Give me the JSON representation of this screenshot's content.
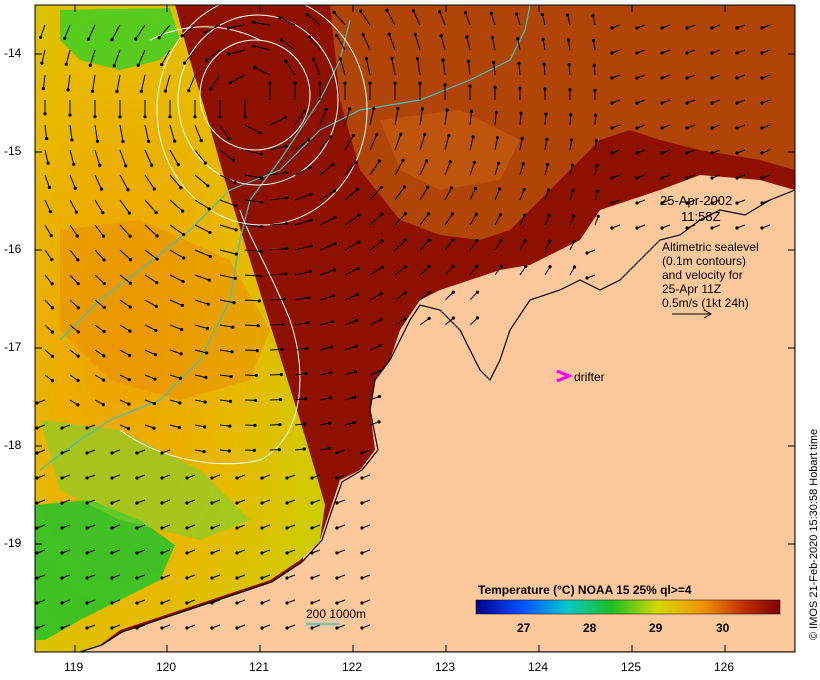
{
  "axes": {
    "lon_ticks": [
      "119",
      "120",
      "121",
      "122",
      "123",
      "124",
      "125",
      "126"
    ],
    "lat_ticks": [
      "-14",
      "-15",
      "-16",
      "-17",
      "-18",
      "-19"
    ]
  },
  "annotations": {
    "date": "25-Apr-2002",
    "time": "11:58Z",
    "legend_lines": [
      "Altimetric sealevel",
      "(0.1m contours)",
      "and velocity for",
      "25-Apr 11Z",
      "0.5m/s (1kt 24h)"
    ],
    "drifter": "drifter",
    "depth_contours": "200  1000m"
  },
  "colorbar": {
    "title": "Temperature (°C) NOAA 15 25% ql>=4",
    "ticks": [
      "27",
      "28",
      "29",
      "30"
    ]
  },
  "credit": "© IMOS 21-Feb-2020 15:30:58 Hobart time",
  "colors": {
    "land": "#fcc89c",
    "warm_sst": "#8e1100",
    "orange_sst": "#b54a08",
    "yellow_sst": "#d7d400",
    "green_sst": "#22c22a",
    "drifter_marker": "#ff00ff",
    "isobath": "#40c0c0"
  }
}
